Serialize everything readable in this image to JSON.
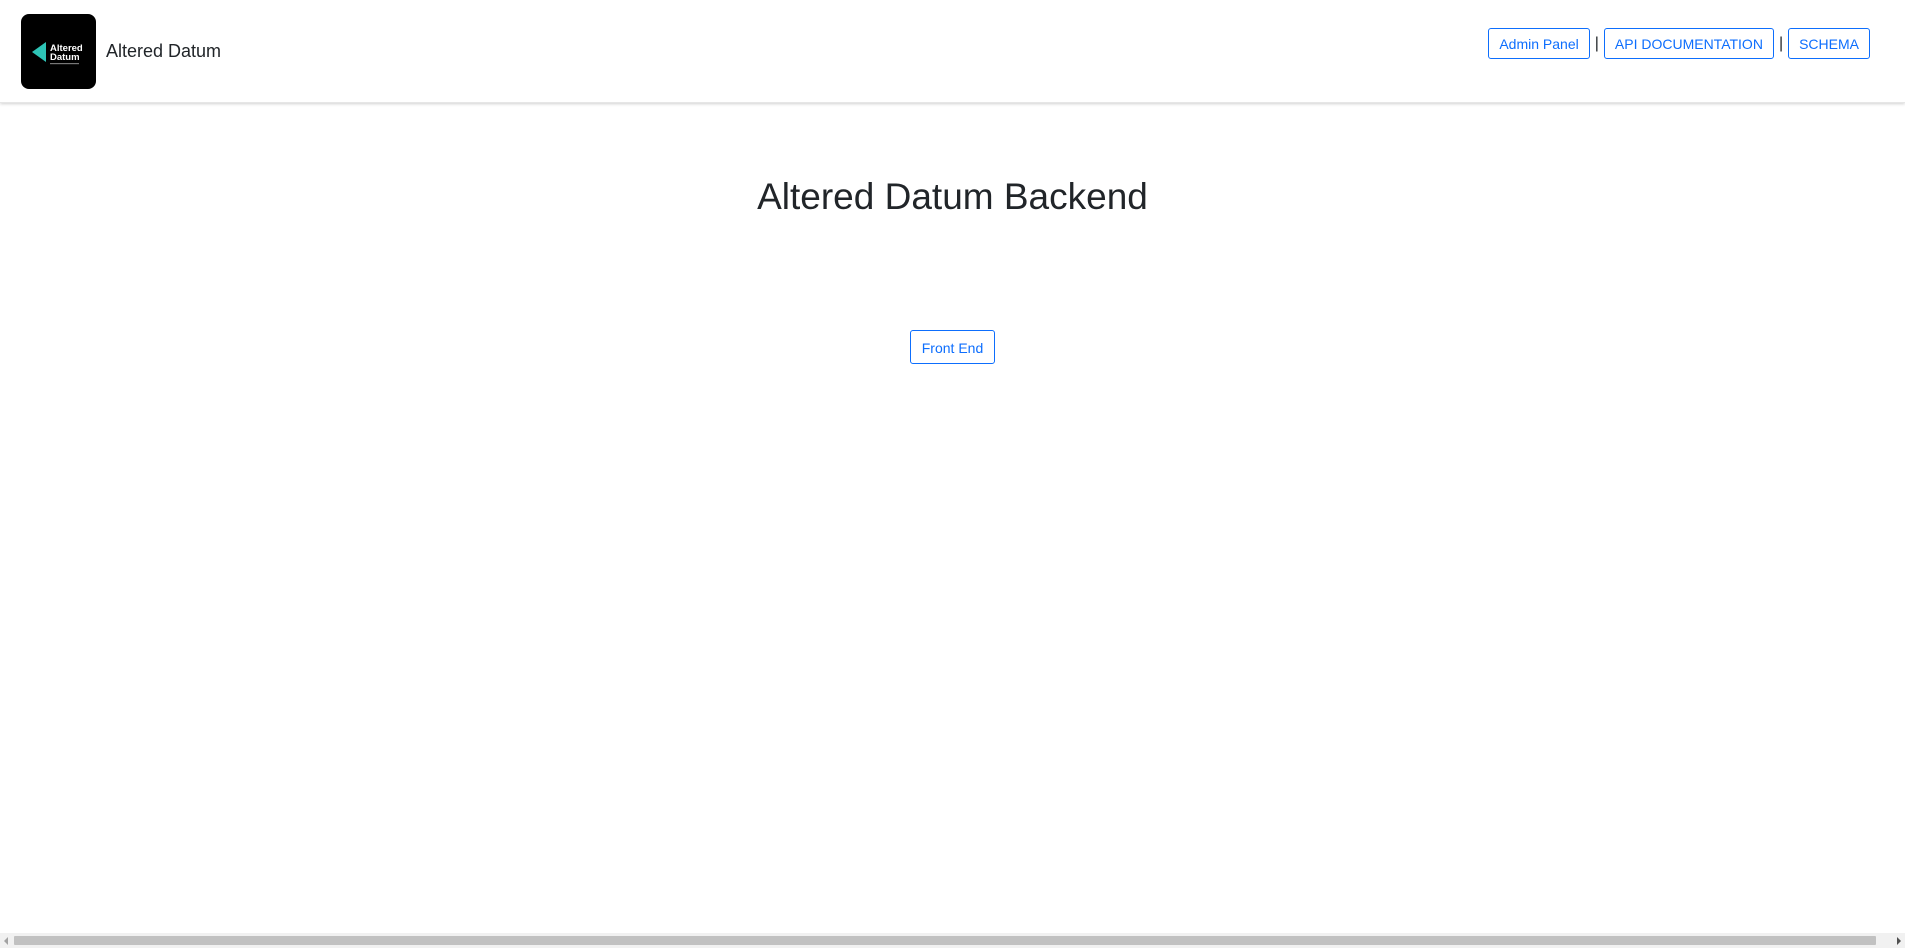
{
  "navbar": {
    "brand": {
      "logo_text_line1": "Altered",
      "logo_text_line2": "Datum",
      "name": "Altered Datum"
    },
    "links": [
      {
        "label": "Admin Panel"
      },
      {
        "label": "API DOCUMENTATION"
      },
      {
        "label": "SCHEMA"
      }
    ],
    "separator": "|"
  },
  "main": {
    "title": "Altered Datum Backend",
    "front_end_label": "Front End"
  },
  "colors": {
    "accent": "#0d6efd",
    "logo_bg": "#000000",
    "logo_triangle": "#2ec4b6",
    "text": "#212529"
  }
}
